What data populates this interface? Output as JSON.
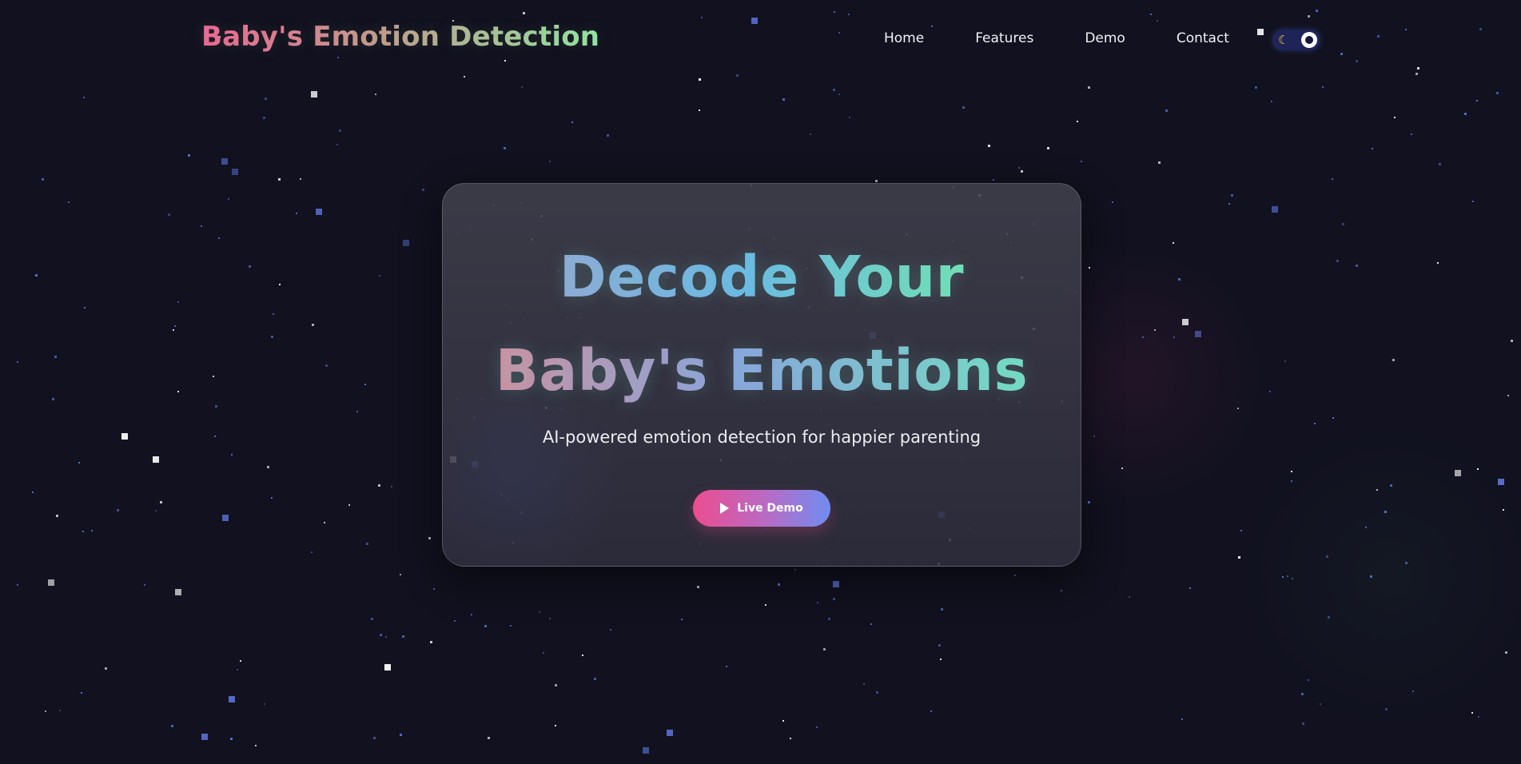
{
  "brand": {
    "title": "Baby's Emotion Detection"
  },
  "nav": {
    "items": [
      {
        "label": "Home"
      },
      {
        "label": "Features"
      },
      {
        "label": "Demo"
      },
      {
        "label": "Contact"
      }
    ]
  },
  "theme_toggle": {
    "icon": "moon-icon",
    "state": "dark"
  },
  "hero": {
    "title_line_1": "Decode Your",
    "title_line_2": "Baby's Emotions",
    "subtitle": "AI-powered emotion detection for happier parenting",
    "cta_label": "Live Demo",
    "cta_icon": "play-icon"
  },
  "colors": {
    "background": "#11111f",
    "card": "#403f4f",
    "accent_pink": "#ec4d8f",
    "accent_blue": "#6f8df1",
    "accent_green": "#73dfb5",
    "star_blue": "#5b73d8",
    "star_white": "#ffffff"
  }
}
